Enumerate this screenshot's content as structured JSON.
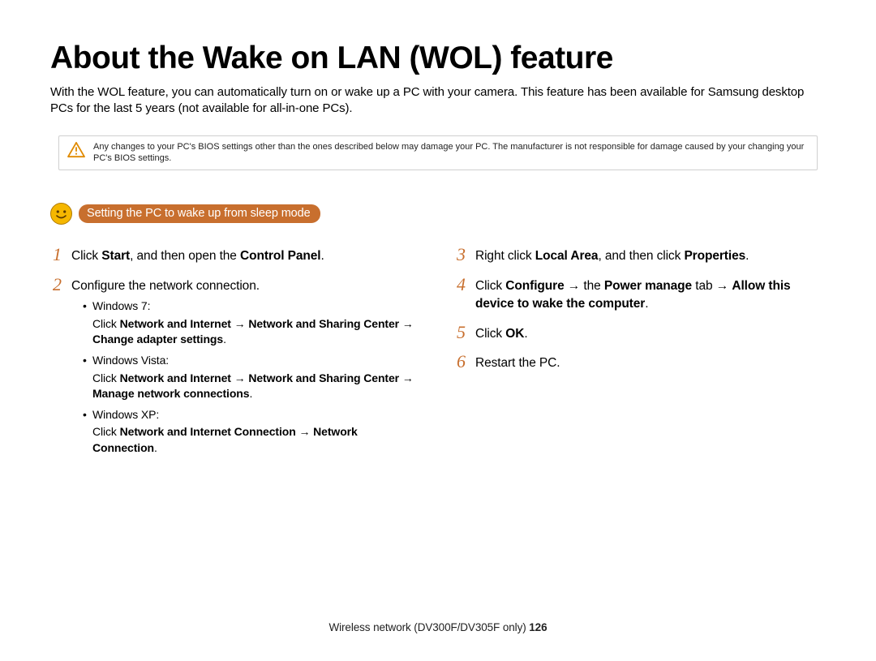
{
  "title": "About the Wake on LAN (WOL) feature",
  "intro": "With the WOL feature, you can automatically turn on or wake up a PC with your camera. This feature has been available for Samsung desktop PCs for the last 5 years (not available for all-in-one PCs).",
  "warning": "Any changes to your PC's BIOS settings other than the ones described below may damage your PC. The manufacturer is not responsible for damage caused by your changing your PC's BIOS settings.",
  "section_badge": "Setting the PC to wake up from sleep mode",
  "steps": {
    "s1": {
      "num": "1",
      "pre": "Click ",
      "b1": "Start",
      "mid": ", and then open the ",
      "b2": "Control Panel",
      "post": "."
    },
    "s2": {
      "num": "2",
      "text": "Configure the network connection.",
      "items": [
        {
          "label": "Windows 7:",
          "click": "Click ",
          "p1": "Network and Internet",
          "a1": " → ",
          "p2": "Network and Sharing Center",
          "a2": " → ",
          "p3": "Change adapter settings",
          "end": "."
        },
        {
          "label": "Windows Vista:",
          "click": "Click ",
          "p1": "Network and Internet",
          "a1": " → ",
          "p2": "Network and Sharing Center",
          "a2": " → ",
          "p3": "Manage network connections",
          "end": "."
        },
        {
          "label": "Windows XP:",
          "click": "Click ",
          "p1": "Network and Internet Connection",
          "a1": " → ",
          "p2": "Network Connection",
          "a2": "",
          "p3": "",
          "end": "."
        }
      ]
    },
    "s3": {
      "num": "3",
      "pre": "Right click ",
      "b1": "Local Area",
      "mid": ", and then click ",
      "b2": "Properties",
      "post": "."
    },
    "s4": {
      "num": "4",
      "pre": "Click ",
      "b1": "Configure",
      "a1": " → the ",
      "b2": "Power manage",
      "a2": " tab → ",
      "b3": "Allow this device to wake the computer",
      "post": "."
    },
    "s5": {
      "num": "5",
      "pre": "Click ",
      "b1": "OK",
      "post": "."
    },
    "s6": {
      "num": "6",
      "text": "Restart the PC."
    }
  },
  "footer": {
    "text": "Wireless network (DV300F/DV305F only)  ",
    "page": "126"
  }
}
